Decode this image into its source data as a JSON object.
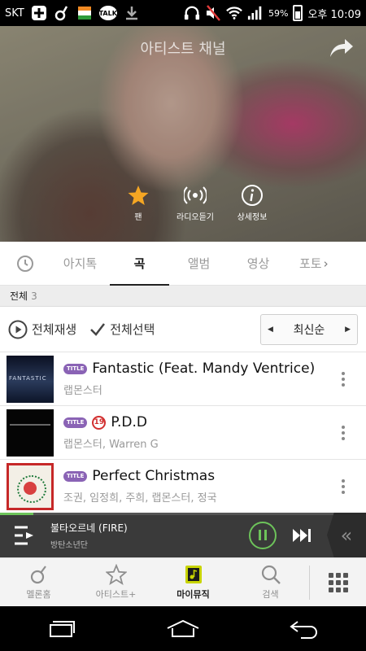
{
  "status_bar": {
    "carrier": "SKT",
    "talk_label": "TALK",
    "battery_percent": "59%",
    "time": "오후 10:09"
  },
  "hero": {
    "title": "아티스트 채널",
    "actions": [
      {
        "label": "팬",
        "icon": "star-icon"
      },
      {
        "label": "라디오듣기",
        "icon": "radio-icon"
      },
      {
        "label": "상세정보",
        "icon": "info-icon"
      }
    ]
  },
  "tabs": [
    {
      "label": "아지톡"
    },
    {
      "label": "곡",
      "active": true
    },
    {
      "label": "앨범"
    },
    {
      "label": "영상"
    },
    {
      "label": "포토"
    }
  ],
  "list_header": {
    "label": "전체",
    "count": "3"
  },
  "actions": {
    "play_all": "전체재생",
    "select_all": "전체선택",
    "sort": "최신순"
  },
  "songs": [
    {
      "badge": "TITLE",
      "title": "Fantastic (Feat. Mandy Ventrice)",
      "artist": "랩몬스터",
      "explicit": false
    },
    {
      "badge": "TITLE",
      "explicit_label": "19",
      "title": "P.D.D",
      "artist": "랩몬스터, Warren G",
      "explicit": true
    },
    {
      "badge": "TITLE",
      "title": "Perfect Christmas",
      "artist": "조권, 임정희, 주희, 랩몬스터, 정국",
      "explicit": false
    }
  ],
  "player": {
    "song": "불타오르네 (FIRE)",
    "artist": "방탄소년단",
    "progress": 0.09,
    "accent_color": "#6dc35a"
  },
  "bottom_nav": [
    {
      "label": "멜론홈",
      "icon": "melon-home-icon"
    },
    {
      "label": "아티스트+",
      "icon": "star-outline-icon"
    },
    {
      "label": "마이뮤직",
      "icon": "my-music-icon",
      "active": true
    },
    {
      "label": "검색",
      "icon": "search-icon"
    }
  ],
  "colors": {
    "title_badge": "#8a63b5",
    "explicit_badge": "#d23030",
    "fan_star": "#f5a623"
  }
}
